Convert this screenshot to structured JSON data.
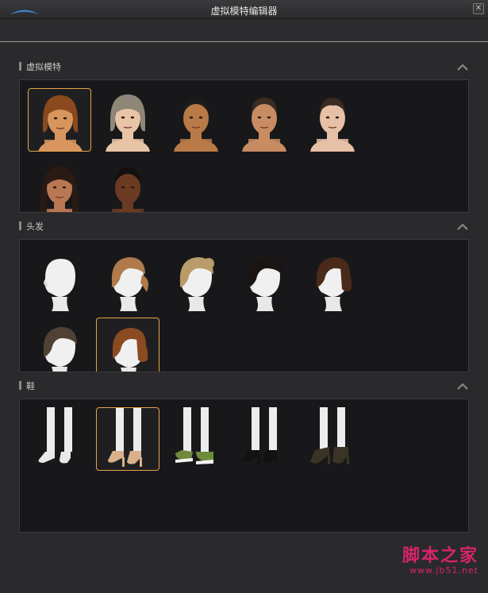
{
  "window": {
    "title": "虚拟模特编辑器",
    "close_glyph": "✕"
  },
  "sections": {
    "models": {
      "title": "虚拟模特",
      "items": [
        {
          "name": "model-1",
          "skin": "#d8965e",
          "hair": "#8a4a1e",
          "style": "bob"
        },
        {
          "name": "model-2",
          "skin": "#e8c4a6",
          "hair": "#8f8678",
          "style": "bob"
        },
        {
          "name": "model-3",
          "skin": "#b97a48",
          "hair": "#1c1c1c",
          "style": "short"
        },
        {
          "name": "model-4",
          "skin": "#c88c62",
          "hair": "#3a2c22",
          "style": "short"
        },
        {
          "name": "model-5",
          "skin": "#e7c0a8",
          "hair": "#3a2a22",
          "style": "child"
        },
        {
          "name": "model-6",
          "skin": "#b97853",
          "hair": "#2a1a14",
          "style": "long"
        },
        {
          "name": "model-7",
          "skin": "#6b3a22",
          "hair": "#141010",
          "style": "short"
        }
      ]
    },
    "hair": {
      "title": "头发",
      "items": [
        {
          "name": "hair-bald",
          "color": "#e6e6e6"
        },
        {
          "name": "hair-ponytail-brown",
          "color": "#b07a4a"
        },
        {
          "name": "hair-bun-blonde",
          "color": "#b99c6a"
        },
        {
          "name": "hair-bun-black",
          "color": "#1a1412"
        },
        {
          "name": "hair-bob-dark-brown",
          "color": "#4a2a1a"
        },
        {
          "name": "hair-short-dark",
          "color": "#4f4234"
        },
        {
          "name": "hair-bob-auburn",
          "color": "#8a4a22"
        }
      ]
    },
    "shoes": {
      "title": "鞋",
      "items": [
        {
          "name": "shoes-barefoot",
          "color": "#e9e9e9"
        },
        {
          "name": "shoes-nude-heels",
          "color": "#d8b08c"
        },
        {
          "name": "shoes-green-sneakers",
          "color": "#6f8a3a"
        },
        {
          "name": "shoes-black-strappy-heels",
          "color": "#121212"
        },
        {
          "name": "shoes-black-ankle-boots",
          "color": "#3a3426"
        }
      ]
    }
  },
  "watermark": {
    "main": "脚本之家",
    "sub": "www.jb51.net"
  },
  "colors": {
    "accent": "#e8a34a",
    "panel_bg": "#18181a",
    "watermark": "#d6246a"
  },
  "icons": {
    "collapse": "chevron-up-icon",
    "close": "close-icon",
    "logo": "app-logo-icon"
  }
}
